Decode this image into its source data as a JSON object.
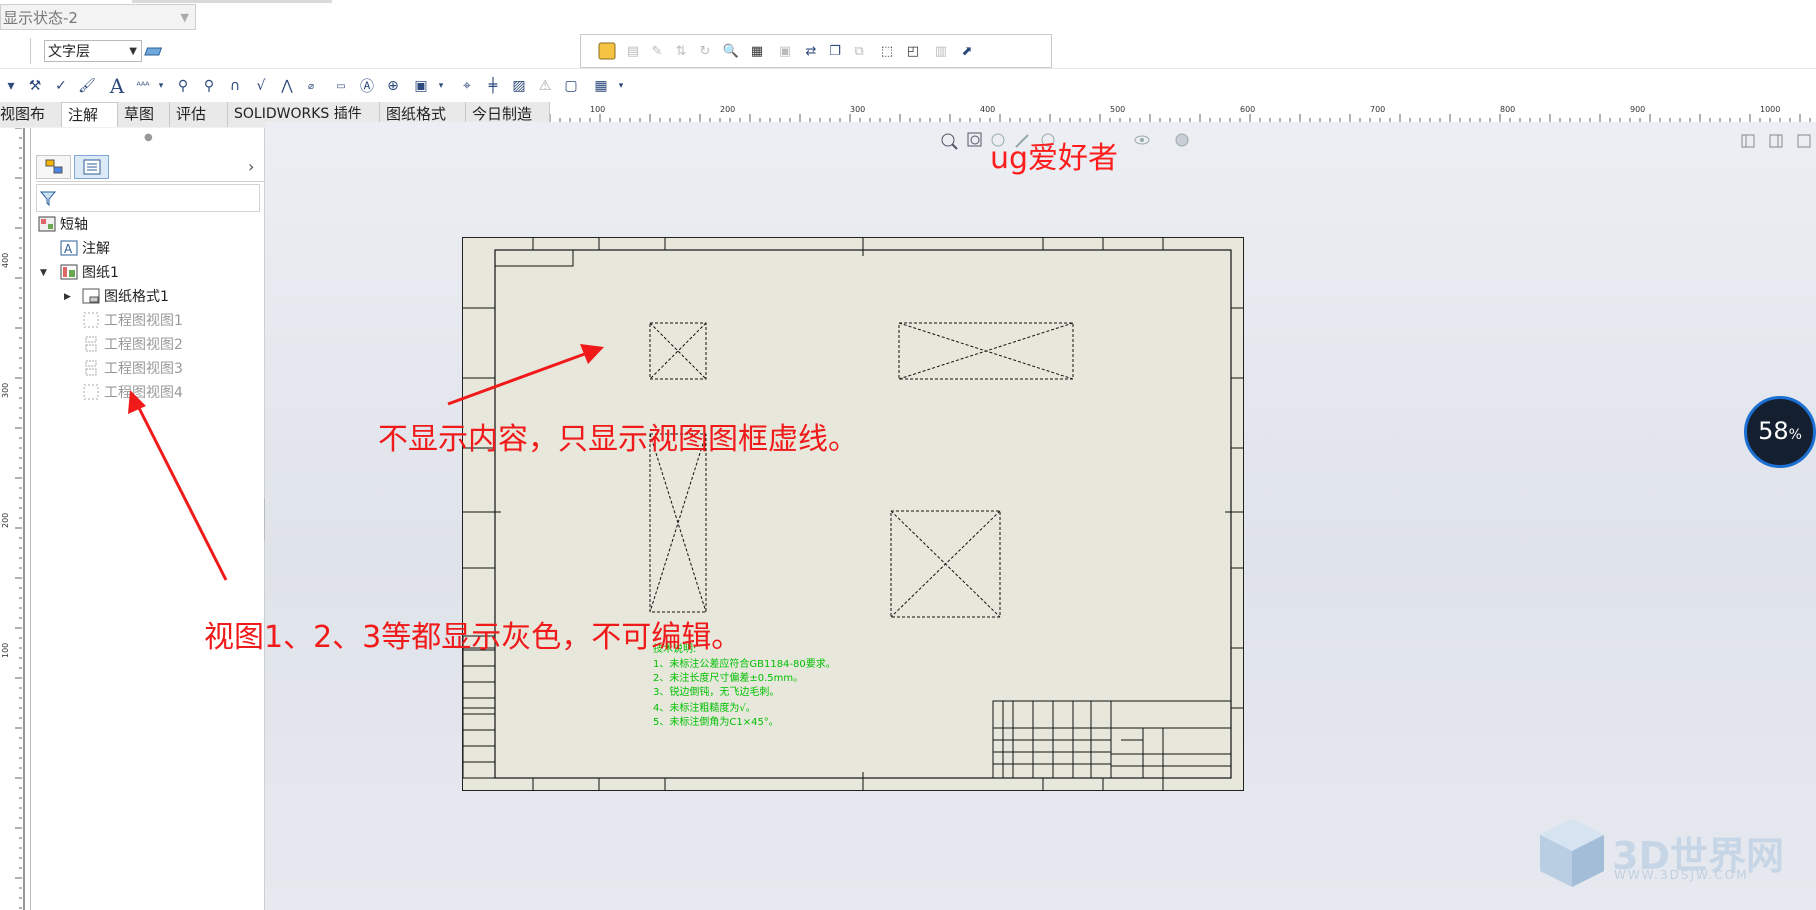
{
  "toolbar": {
    "display_state": "显示状态-2",
    "layer_select": "文字层"
  },
  "tabs": [
    "视图布局",
    "注解",
    "草图",
    "评估",
    "SOLIDWORKS 插件",
    "图纸格式",
    "今日制造"
  ],
  "active_tab": "注解",
  "ruler_top_labels": [
    "100",
    "200",
    "300",
    "400",
    "500",
    "600",
    "700",
    "800",
    "900",
    "1000"
  ],
  "ruler_left_labels": [
    "400",
    "300",
    "200",
    "100"
  ],
  "tree": {
    "root": "短轴",
    "annotations": "注解",
    "sheet": "图纸1",
    "sheet_format": "图纸格式1",
    "views": [
      "工程图视图1",
      "工程图视图2",
      "工程图视图3",
      "工程图视图4"
    ]
  },
  "overlay": {
    "watermark_top": "ug爱好者",
    "note_frames": "不显示内容，只显示视图图框虚线。",
    "note_grey": "视图1、2、3等都显示灰色，不可编辑。",
    "progress_value": "58",
    "progress_unit": "%",
    "logo_name": "3D世界网",
    "logo_url": "WWW.3DSJW.COM"
  },
  "drawing": {
    "tech_notes_title": "技术说明:",
    "tech_notes": [
      "1、未标注公差应符合GB1184-80要求。",
      "2、未注长度尺寸偏差±0.5mm。",
      "3、锐边倒钝，无飞边毛刺。",
      "4、未标注粗糙度为√。",
      "5、未标注倒角为C1×45°。"
    ]
  },
  "colors": {
    "annotation_red": "#f01a1a",
    "sheet_bg": "#e8e7dc",
    "notes_green": "#00c000",
    "progress_ring": "#1e6fd2"
  }
}
